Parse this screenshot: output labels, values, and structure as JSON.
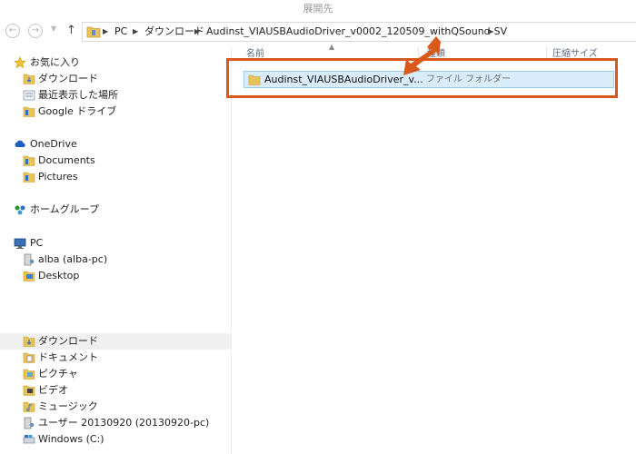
{
  "window": {
    "title": "展開先"
  },
  "nav": {
    "back_icon": "back-arrow-icon",
    "forward_icon": "forward-arrow-icon",
    "recent_icon": "chevron-down-icon",
    "up_icon": "up-arrow-icon"
  },
  "breadcrumb": {
    "segments": [
      {
        "label": "PC"
      },
      {
        "label": "ダウンロード"
      },
      {
        "label": "Audinst_VIAUSBAudioDriver_v0002_120509_withQSound-SV"
      }
    ]
  },
  "columns": {
    "name": "名前",
    "type": "種類",
    "size": "圧縮サイズ"
  },
  "files": [
    {
      "name": "Audinst_VIAUSBAudioDriver_v...",
      "type": "ファイル フォルダー"
    }
  ],
  "sidebar": {
    "favorites": {
      "label": "お気に入り",
      "items": [
        {
          "label": "ダウンロード"
        },
        {
          "label": "最近表示した場所"
        },
        {
          "label": "Google ドライブ"
        }
      ]
    },
    "onedrive": {
      "label": "OneDrive",
      "items": [
        {
          "label": "Documents"
        },
        {
          "label": "Pictures"
        }
      ]
    },
    "homegroup": {
      "label": "ホームグループ"
    },
    "pc": {
      "label": "PC",
      "items": [
        {
          "label": "alba (alba-pc)"
        },
        {
          "label": "Desktop"
        }
      ]
    },
    "libraries": [
      {
        "label": "ダウンロード"
      },
      {
        "label": "ドキュメント"
      },
      {
        "label": "ピクチャ"
      },
      {
        "label": "ビデオ"
      },
      {
        "label": "ミュージック"
      },
      {
        "label": "ユーザー 20130920 (20130920-pc)"
      },
      {
        "label": "Windows (C:)"
      }
    ]
  },
  "colors": {
    "highlight": "#d9591c",
    "selection_bg": "#d9ecf9",
    "selection_border": "#9bcdf0",
    "folder": "#e8c35a"
  }
}
